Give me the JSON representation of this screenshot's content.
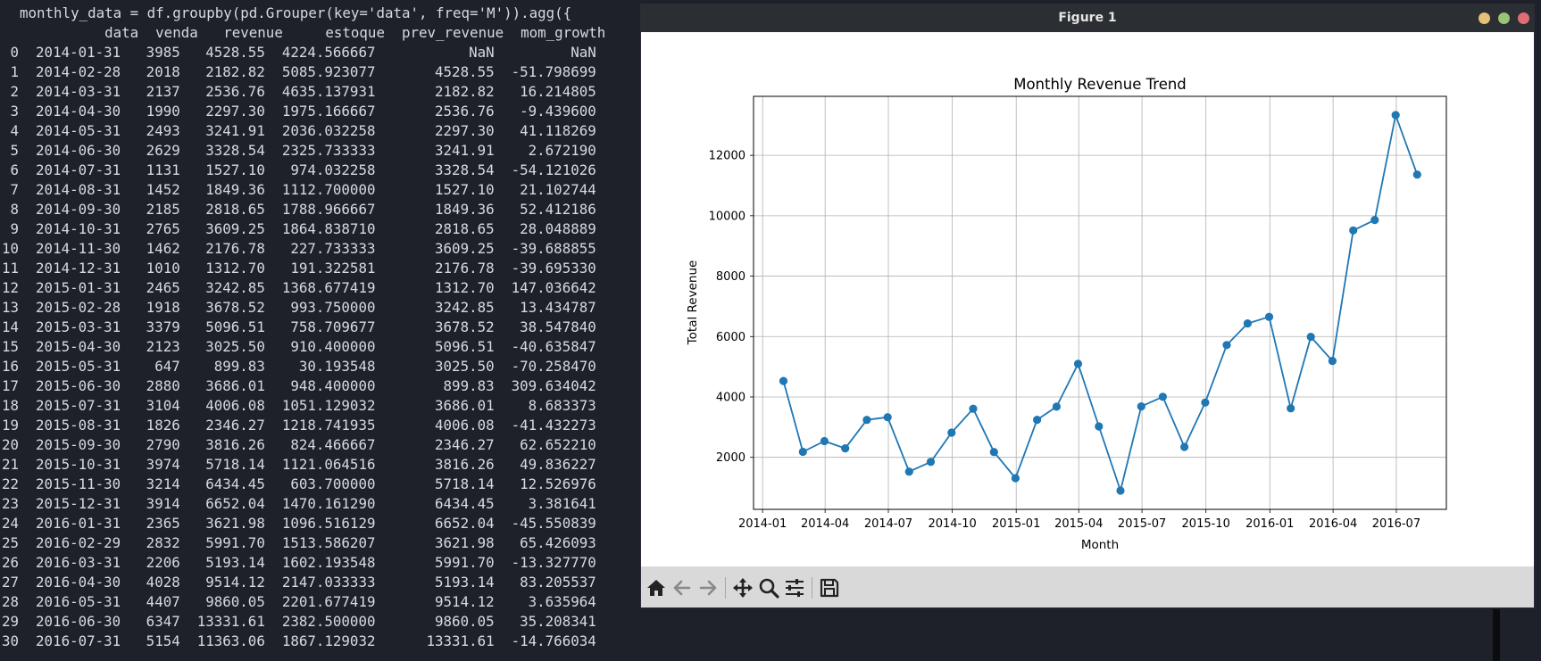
{
  "terminal": {
    "command": "monthly_data = df.groupby(pd.Grouper(key='data', freq='M')).agg({",
    "header": "          data  venda   revenue     estoque  prev_revenue  mom_growth",
    "rows": [
      " 0  2014-01-31   3985   4528.55  4224.566667           NaN         NaN",
      " 1  2014-02-28   2018   2182.82  5085.923077       4528.55  -51.798699",
      " 2  2014-03-31   2137   2536.76  4635.137931       2182.82   16.214805",
      " 3  2014-04-30   1990   2297.30  1975.166667       2536.76   -9.439600",
      " 4  2014-05-31   2493   3241.91  2036.032258       2297.30   41.118269",
      " 5  2014-06-30   2629   3328.54  2325.733333       3241.91    2.672190",
      " 6  2014-07-31   1131   1527.10   974.032258       3328.54  -54.121026",
      " 7  2014-08-31   1452   1849.36  1112.700000       1527.10   21.102744",
      " 8  2014-09-30   2185   2818.65  1788.966667       1849.36   52.412186",
      " 9  2014-10-31   2765   3609.25  1864.838710       2818.65   28.048889",
      "10  2014-11-30   1462   2176.78   227.733333       3609.25  -39.688855",
      "11  2014-12-31   1010   1312.70   191.322581       2176.78  -39.695330",
      "12  2015-01-31   2465   3242.85  1368.677419       1312.70  147.036642",
      "13  2015-02-28   1918   3678.52   993.750000       3242.85   13.434787",
      "14  2015-03-31   3379   5096.51   758.709677       3678.52   38.547840",
      "15  2015-04-30   2123   3025.50   910.400000       5096.51  -40.635847",
      "16  2015-05-31    647    899.83    30.193548       3025.50  -70.258470",
      "17  2015-06-30   2880   3686.01   948.400000        899.83  309.634042",
      "18  2015-07-31   3104   4006.08  1051.129032       3686.01    8.683373",
      "19  2015-08-31   1826   2346.27  1218.741935       4006.08  -41.432273",
      "20  2015-09-30   2790   3816.26   824.466667       2346.27   62.652210",
      "21  2015-10-31   3974   5718.14  1121.064516       3816.26   49.836227",
      "22  2015-11-30   3214   6434.45   603.700000       5718.14   12.526976",
      "23  2015-12-31   3914   6652.04  1470.161290       6434.45    3.381641",
      "24  2016-01-31   2365   3621.98  1096.516129       6652.04  -45.550839",
      "25  2016-02-29   2832   5991.70  1513.586207       3621.98   65.426093",
      "26  2016-03-31   2206   5193.14  1602.193548       5991.70  -13.327770",
      "27  2016-04-30   4028   9514.12  2147.033333       5193.14   83.205537",
      "28  2016-05-31   4407   9860.05  2201.677419       9514.12    3.635964",
      "29  2016-06-30   6347  13331.61  2382.500000       9860.05   35.208341",
      "30  2016-07-31   5154  11363.06  1867.129032      13331.61  -14.766034"
    ]
  },
  "window": {
    "title": "Figure 1",
    "controls": [
      "minimize-button",
      "maximize-button",
      "close-button"
    ],
    "control_colors": {
      "minimize": "#e5c07b",
      "maximize": "#98c379",
      "close": "#e06c75"
    }
  },
  "toolbar": {
    "buttons": [
      "home-icon",
      "back-icon",
      "forward-icon",
      "pan-icon",
      "zoom-icon",
      "configure-subplots-icon",
      "save-icon"
    ]
  },
  "chart_data": {
    "type": "line",
    "title": "Monthly Revenue Trend",
    "xlabel": "Month",
    "ylabel": "Total Revenue",
    "x": [
      "2014-01-31",
      "2014-02-28",
      "2014-03-31",
      "2014-04-30",
      "2014-05-31",
      "2014-06-30",
      "2014-07-31",
      "2014-08-31",
      "2014-09-30",
      "2014-10-31",
      "2014-11-30",
      "2014-12-31",
      "2015-01-31",
      "2015-02-28",
      "2015-03-31",
      "2015-04-30",
      "2015-05-31",
      "2015-06-30",
      "2015-07-31",
      "2015-08-31",
      "2015-09-30",
      "2015-10-31",
      "2015-11-30",
      "2015-12-31",
      "2016-01-31",
      "2016-02-29",
      "2016-03-31",
      "2016-04-30",
      "2016-05-31",
      "2016-06-30",
      "2016-07-31"
    ],
    "series": [
      {
        "values": [
          4528.55,
          2182.82,
          2536.76,
          2297.3,
          3241.91,
          3328.54,
          1527.1,
          1849.36,
          2818.65,
          3609.25,
          2176.78,
          1312.7,
          3242.85,
          3678.52,
          5096.51,
          3025.5,
          899.83,
          3686.01,
          4006.08,
          2346.27,
          3816.26,
          5718.14,
          6434.45,
          6652.04,
          3621.98,
          5991.7,
          5193.14,
          9514.12,
          9860.05,
          13331.61,
          11363.06
        ]
      }
    ],
    "xticks": [
      "2014-01",
      "2014-04",
      "2014-07",
      "2014-10",
      "2015-01",
      "2015-04",
      "2015-07",
      "2015-10",
      "2016-01",
      "2016-04",
      "2016-07"
    ],
    "yticks": [
      2000,
      4000,
      6000,
      8000,
      10000,
      12000
    ],
    "xlim": [
      "2013-12-19",
      "2016-09-11"
    ],
    "ylim": [
      278.2,
      13953.2
    ],
    "grid": true,
    "line_color": "#1f77b4",
    "marker": "circle"
  }
}
